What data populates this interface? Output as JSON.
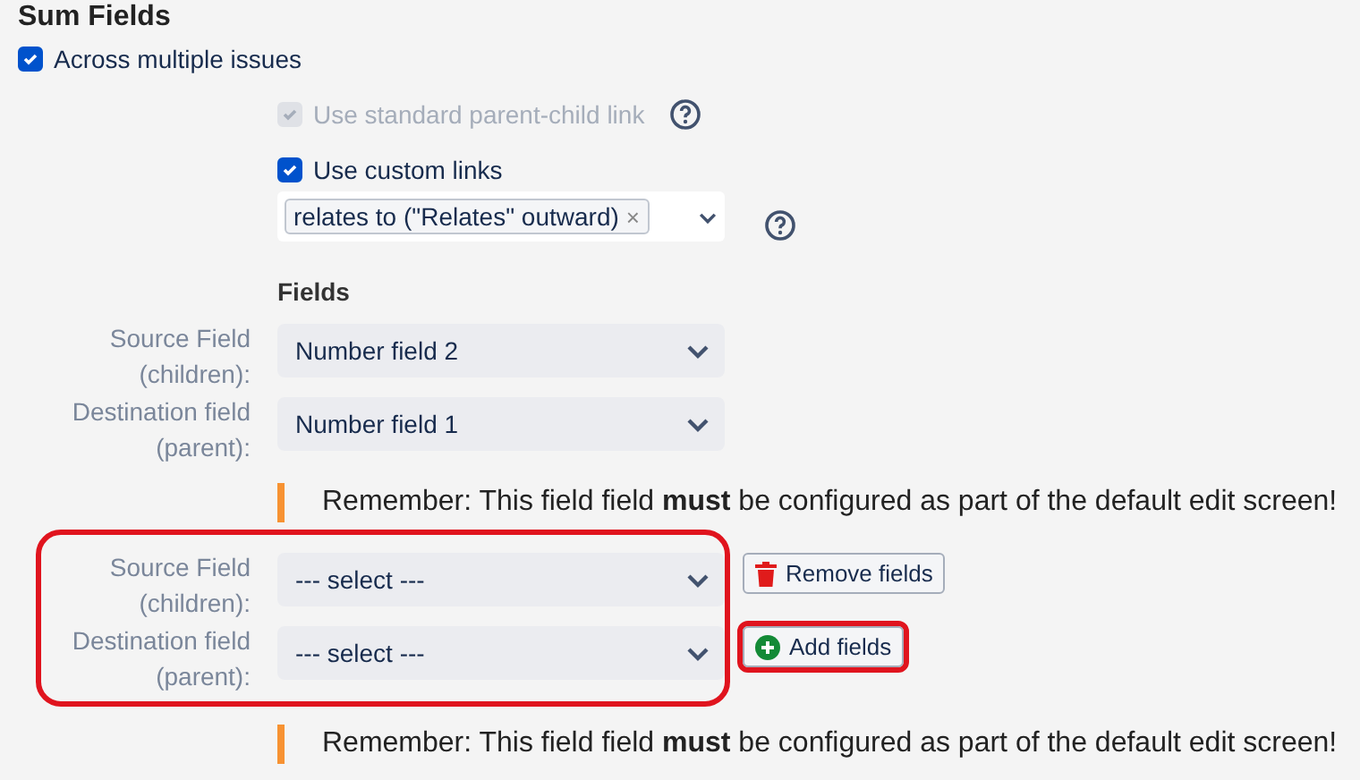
{
  "title": "Sum Fields",
  "across": {
    "label": "Across multiple issues",
    "checked": true
  },
  "standard_link": {
    "label": "Use standard parent-child link",
    "checked": true,
    "disabled": true
  },
  "custom_links": {
    "label": "Use custom links",
    "checked": true,
    "disabled": false,
    "tags": [
      "relates to (\"Relates\" outward)"
    ],
    "remove_glyph": "×"
  },
  "fields_heading": "Fields",
  "groups": [
    {
      "highlighted": false,
      "rows": [
        {
          "label": "Source Field (children):",
          "value": "Number field 2"
        },
        {
          "label": "Destination field (parent):",
          "value": "Number field 1"
        }
      ],
      "notice": "Remember: This field field **must** be configured as part of the default edit screen!"
    },
    {
      "highlighted": true,
      "rows": [
        {
          "label": "Source Field (children):",
          "value": "--- select ---"
        },
        {
          "label": "Destination field (parent):",
          "value": "--- select ---"
        }
      ],
      "buttons": [
        {
          "kind": "remove",
          "label": "Remove fields",
          "highlighted": false
        },
        {
          "kind": "add",
          "label": "Add fields",
          "highlighted": true
        }
      ],
      "notice": "Remember: This field field **must** be configured as part of the default edit screen!"
    }
  ]
}
